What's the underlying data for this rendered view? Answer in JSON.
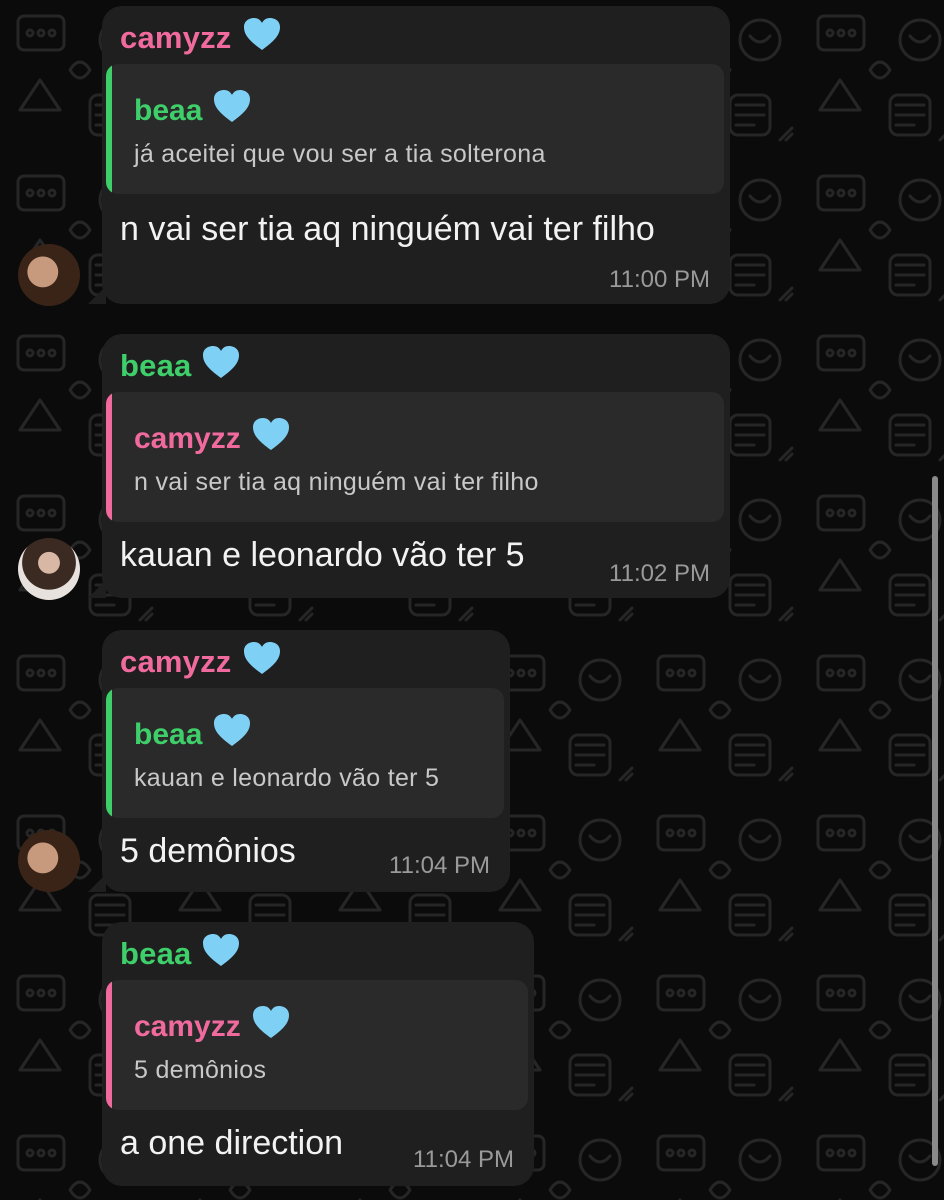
{
  "colors": {
    "background": "#0b0b0b",
    "bubble": "#1f1f1f",
    "quote_bg": "#2a2a2a",
    "beaa_name": "#3fcf6a",
    "camyzz_name": "#f06a9e",
    "timestamp": "#9a9a9a",
    "heart": "#7fd0f5"
  },
  "messages": [
    {
      "sender": "camyzz",
      "quote_sender": "beaa",
      "quote_text": "já aceitei que vou ser a tia solterona",
      "text": "n vai ser tia aq ninguém vai ter filho",
      "time": "11:00 PM"
    },
    {
      "sender": "beaa",
      "quote_sender": "camyzz",
      "quote_text": "n vai ser tia aq ninguém vai ter filho",
      "text": "kauan e leonardo vão ter 5",
      "time": "11:02 PM"
    },
    {
      "sender": "camyzz",
      "quote_sender": "beaa",
      "quote_text": "kauan e leonardo vão ter 5",
      "text": "5 demônios",
      "time": "11:04 PM"
    },
    {
      "sender": "beaa",
      "quote_sender": "camyzz",
      "quote_text": "5 demônios",
      "text": "a one direction",
      "time": "11:04 PM"
    }
  ]
}
